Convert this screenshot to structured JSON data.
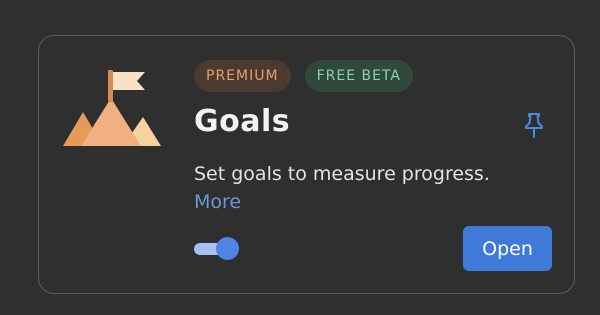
{
  "card": {
    "badges": [
      {
        "label": "PREMIUM"
      },
      {
        "label": "FREE BETA"
      }
    ],
    "title": "Goals",
    "description": "Set goals to measure progress.",
    "more_link": "More",
    "open_button": "Open",
    "toggle": {
      "enabled": true
    },
    "icons": {
      "logo": "mountain-flag-icon",
      "pin": "pin-icon"
    }
  },
  "colors": {
    "background": "#2f2f2f",
    "card_border": "#5c5c5c",
    "premium_badge_bg": "#4b3a2f",
    "premium_badge_text": "#e7a06e",
    "beta_badge_bg": "#2f4a3d",
    "beta_badge_text": "#8fd0a8",
    "accent": "#3f7ad8",
    "link": "#6f97d6"
  }
}
